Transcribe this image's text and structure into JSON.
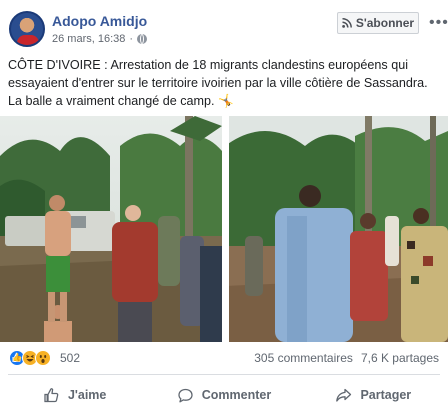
{
  "post": {
    "author": "Adopo Amidjo",
    "date": "26 mars, 16:38",
    "meta_separator": "·",
    "subscribe_label": "S'abonner",
    "more_label": "•••",
    "text_line1": "CÔTE D'IVOIRE : Arrestation de 18 migrants clandestins européens qui",
    "text_line2": "essayaient d'entrer sur le territoire ivoirien par la ville côtière de Sassandra.",
    "text_line3": "La balle a vraiment changé de camp. 🤸"
  },
  "reactions": {
    "count": "502",
    "comments": "305 commentaires",
    "shares": "7,6 K partages",
    "icons": [
      "like-icon",
      "haha-icon",
      "wow-icon"
    ]
  },
  "actions": {
    "like": "J'aime",
    "comment": "Commenter",
    "share": "Partager"
  },
  "colors": {
    "author": "#385898",
    "like_blue": "#1877f2",
    "reaction_yellow": "#f7b125",
    "muted": "#606770"
  }
}
